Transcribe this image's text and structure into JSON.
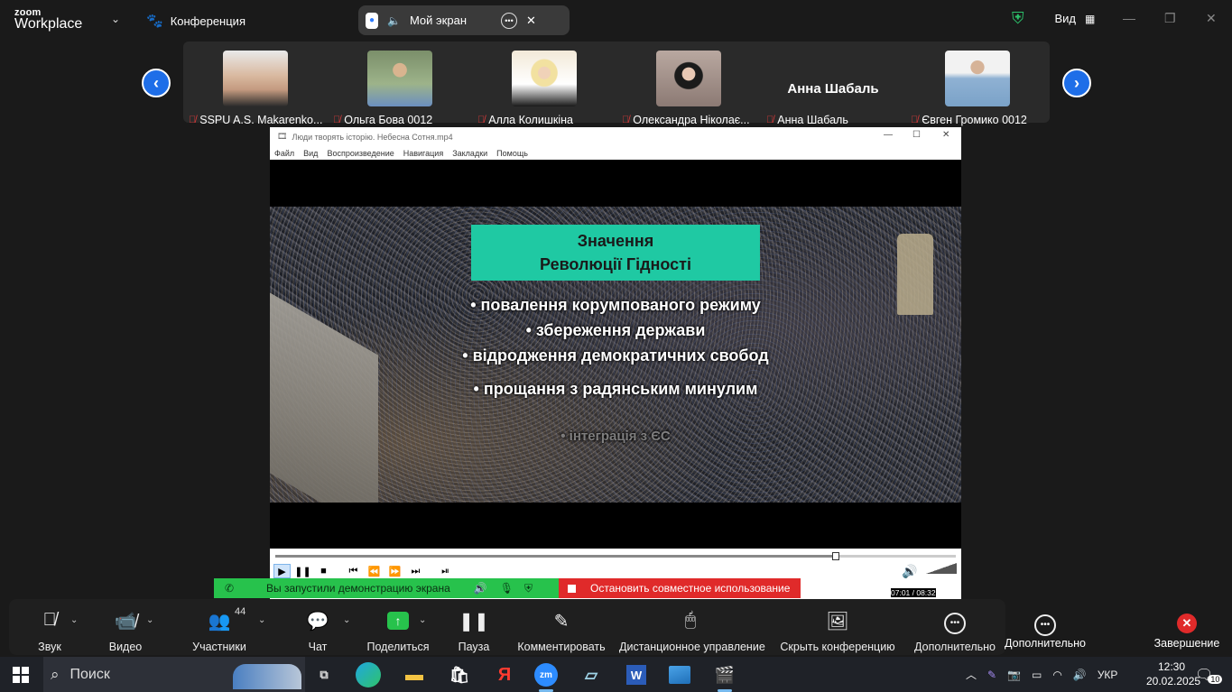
{
  "topbar": {
    "logo_small": "zoom",
    "logo_big": "Workplace",
    "conference_label": "Конференция",
    "share_pill_label": "Мой экран",
    "view_label": "Вид"
  },
  "participants": {
    "items": [
      {
        "name": "SSPU A.S. Makarenko..."
      },
      {
        "name": "Ольга Бова 0012"
      },
      {
        "name": "Алла Колишкіна"
      },
      {
        "name": "Олександра Ніколає..."
      },
      {
        "name": "Анна Шабаль",
        "tile_text": "Анна Шабаль"
      },
      {
        "name": "Євген Громико 0012"
      }
    ]
  },
  "player": {
    "title": "Люди творять історію. Небесна Сотня.mp4",
    "menu": [
      "Файл",
      "Вид",
      "Воспроизведение",
      "Навигация",
      "Закладки",
      "Помощь"
    ],
    "slide": {
      "heading_line1": "Значення",
      "heading_line2": "Революції Гідності",
      "bullets": [
        "• повалення корумпованого режиму",
        "• збереження держави",
        "• відродження демократичних свобод",
        "• прощання з радянським минулим"
      ],
      "faded_bullet": "• інтеграція з ЄС"
    },
    "time": "07:01 / 08:32",
    "progress_fraction": 0.823
  },
  "share_banner": {
    "started_text": "Вы запустили демонстрацию экрана",
    "stop_text": "Остановить совместное использование"
  },
  "toolbar": {
    "audio": "Звук",
    "video": "Видео",
    "participants": "Участники",
    "participants_count": "44",
    "chat": "Чат",
    "share": "Поделиться",
    "pause": "Пауза",
    "annotate": "Комментировать",
    "remote_control": "Дистанционное управление",
    "hide_conf": "Скрыть конференцию",
    "more": "Дополнительно",
    "more_outside": "Дополнительно",
    "end": "Завершение"
  },
  "taskbar": {
    "search_placeholder": "Поиск",
    "lang": "УКР",
    "time": "12:30",
    "date": "20.02.2025",
    "notification_count": "10"
  },
  "colors": {
    "share_green": "#27c24c",
    "stop_red": "#e02a2a",
    "slide_heading_bg": "#1fc9a3",
    "nav_blue": "#1e6ee8"
  }
}
